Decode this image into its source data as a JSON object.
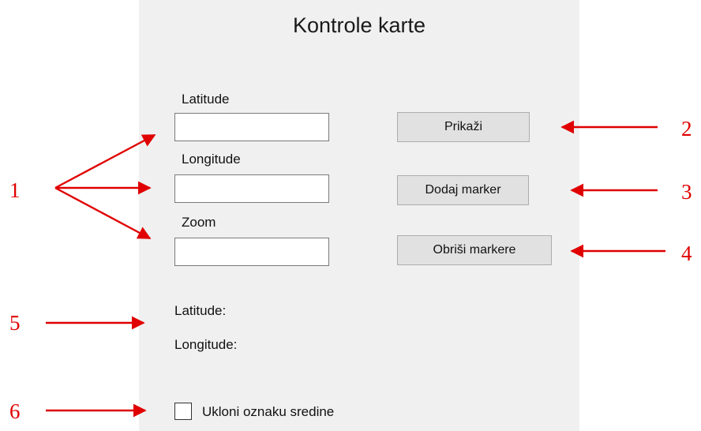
{
  "panel": {
    "title": "Kontrole karte",
    "fields": [
      {
        "label": "Latitude",
        "value": ""
      },
      {
        "label": "Longitude",
        "value": ""
      },
      {
        "label": "Zoom",
        "value": ""
      }
    ],
    "buttons": {
      "show": "Prikaži",
      "add_marker": "Dodaj marker",
      "delete_markers": "Obriši markere"
    },
    "readouts": {
      "latitude_label": "Latitude:",
      "longitude_label": "Longitude:"
    },
    "checkbox": {
      "label": "Ukloni oznaku sredine",
      "checked": false
    }
  },
  "annotations": {
    "numbers": [
      "1",
      "2",
      "3",
      "4",
      "5",
      "6"
    ],
    "arrow_color": "#e00000"
  }
}
